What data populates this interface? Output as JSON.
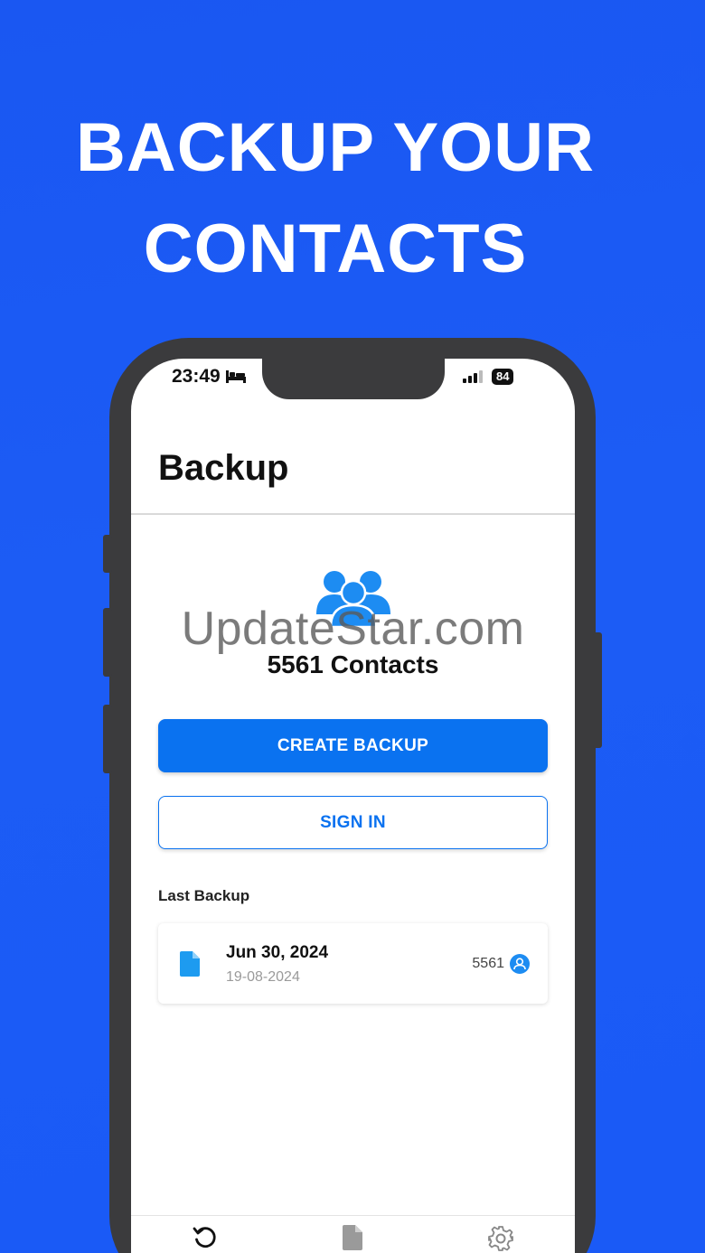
{
  "promo": {
    "headline_line1": "BACKUP YOUR",
    "headline_line2": "CONTACTS"
  },
  "status_bar": {
    "time": "23:49",
    "battery": "84"
  },
  "header": {
    "title": "Backup"
  },
  "summary": {
    "contacts_label": "5561 Contacts",
    "watermark": "UpdateStar.com"
  },
  "actions": {
    "create_backup": "CREATE BACKUP",
    "sign_in": "SIGN IN"
  },
  "last_backup": {
    "section_label": "Last Backup",
    "date": "Jun 30, 2024",
    "subdate": "19-08-2024",
    "count": "5561"
  },
  "tabs": [
    {
      "icon": "restore-icon"
    },
    {
      "icon": "file-icon"
    },
    {
      "icon": "gear-icon"
    }
  ],
  "colors": {
    "background": "#1a57f2",
    "accent": "#0a72f0",
    "icon_blue": "#1d8cf2"
  }
}
